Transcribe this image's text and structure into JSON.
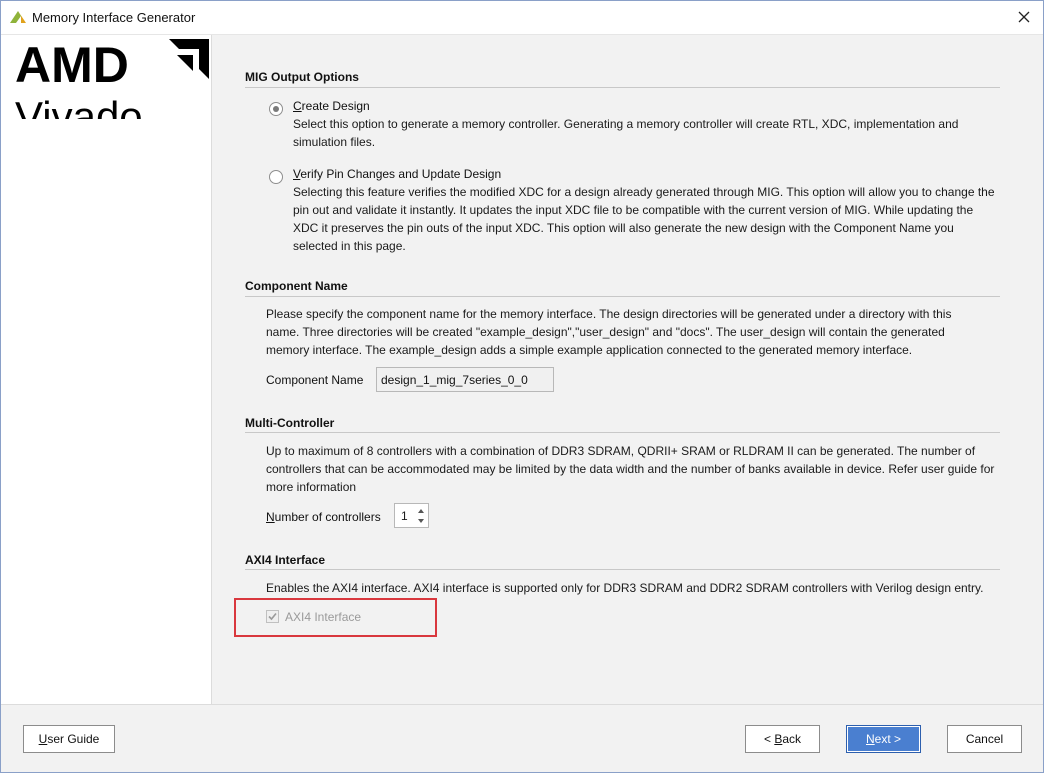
{
  "window": {
    "title": "Memory Interface Generator",
    "close_icon": "close-icon",
    "app_icon": "vivado-logo-icon"
  },
  "sidebar": {
    "brand": "AMD",
    "product": "Vivado"
  },
  "mig_output": {
    "title": "MIG Output Options",
    "create": {
      "label_first": "C",
      "label_rest": "reate Design",
      "desc": "Select this option to generate a memory controller. Generating a memory controller will create RTL, XDC, implementation and simulation files.",
      "selected": true
    },
    "verify": {
      "label_first": "V",
      "label_rest": "erify Pin Changes and Update Design",
      "desc": "Selecting this feature verifies the modified XDC for a design already generated through MIG. This option will allow you to change the pin out and validate it instantly. It updates the input XDC file to be compatible with the current version of MIG. While updating the XDC it preserves the pin outs of the input XDC. This option will also generate the new design with the Component Name you selected in this page.",
      "selected": false
    }
  },
  "component": {
    "title": "Component Name",
    "desc": "Please specify the component name for the memory interface. The design directories will be generated under a directory with this name. Three directories will be created \"example_design\",\"user_design\" and \"docs\". The user_design will contain the generated memory interface. The example_design adds a simple example application connected to the generated memory interface.",
    "label": "Component Name",
    "value": "design_1_mig_7series_0_0"
  },
  "multi": {
    "title": "Multi-Controller",
    "desc": "Up to maximum of 8 controllers with a combination of DDR3 SDRAM, QDRII+ SRAM or RLDRAM II can be generated. The number of controllers that can be accommodated may be limited by the data width and the number of banks available in device. Refer user guide for more information",
    "label_first": "N",
    "label_rest": "umber of controllers",
    "value": "1"
  },
  "axi": {
    "title": "AXI4 Interface",
    "desc": "Enables the AXI4 interface. AXI4 interface is supported only for DDR3 SDRAM and DDR2 SDRAM controllers with Verilog design entry.",
    "checkbox_label": "AXI4 Interface",
    "checked": true,
    "enabled": false,
    "highlight_color": "#d9383e"
  },
  "footer": {
    "user_guide_first": "U",
    "user_guide_rest": "ser Guide",
    "back_prefix": "< ",
    "back_first": "B",
    "back_rest": "ack",
    "next_first": "N",
    "next_rest": "ext >",
    "cancel": "Cancel"
  },
  "colors": {
    "accent": "#4a7fd0",
    "background": "#f2f2f2"
  }
}
